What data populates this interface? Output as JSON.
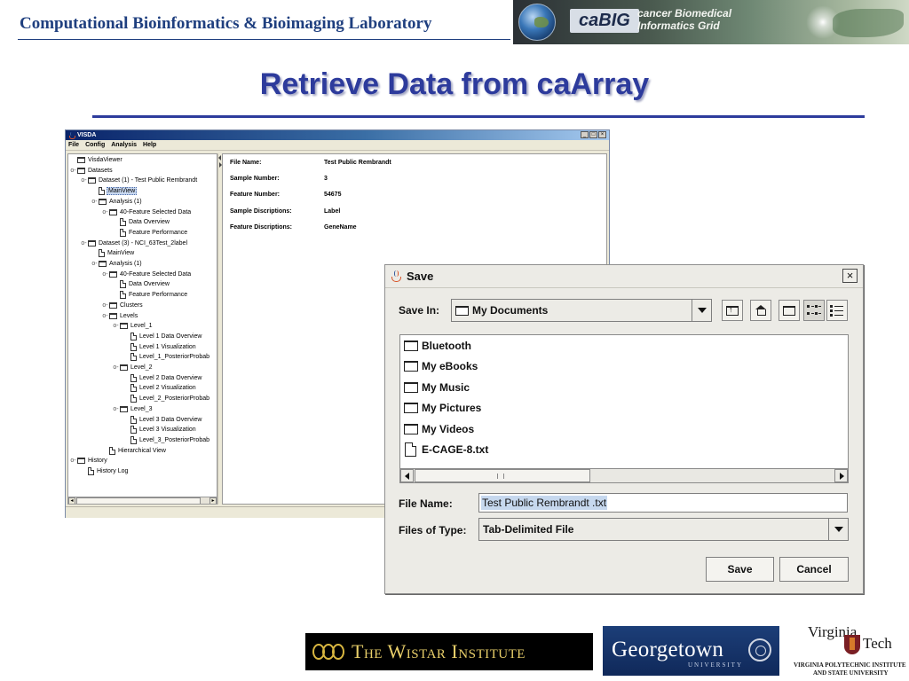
{
  "slide": {
    "lab_name": "Computational Bioinformatics & Bioimaging Laboratory",
    "title": "Retrieve Data from caArray",
    "banner": {
      "logo_text": "caBIG",
      "subtitle_line1": "cancer Biomedical",
      "subtitle_line2": "Informatics Grid"
    }
  },
  "visda": {
    "title": "VISDA",
    "menu": [
      "File",
      "Config",
      "Analysis",
      "Help"
    ],
    "tree": [
      {
        "label": "VisdaViewer",
        "icon": "folder-icon",
        "toggle": ""
      },
      {
        "label": "Datasets",
        "icon": "folder-icon",
        "toggle": "o-"
      },
      {
        "label": "Dataset (1) - Test Public Rembrandt",
        "icon": "folder-icon",
        "toggle": "o-"
      },
      {
        "label": "MainView",
        "icon": "file-icon",
        "toggle": "",
        "selected": true
      },
      {
        "label": "Analysis (1)",
        "icon": "folder-icon",
        "toggle": "o-"
      },
      {
        "label": "40-Feature Selected Data",
        "icon": "folder-icon",
        "toggle": "o-"
      },
      {
        "label": "Data Overview",
        "icon": "file-icon",
        "toggle": ""
      },
      {
        "label": "Feature Performance",
        "icon": "file-icon",
        "toggle": ""
      },
      {
        "label": "Dataset (3) - NCI_63Test_2label",
        "icon": "folder-icon",
        "toggle": "o-"
      },
      {
        "label": "MainView",
        "icon": "file-icon",
        "toggle": ""
      },
      {
        "label": "Analysis (1)",
        "icon": "folder-icon",
        "toggle": "o-"
      },
      {
        "label": "40-Feature Selected Data",
        "icon": "folder-icon",
        "toggle": "o-"
      },
      {
        "label": "Data Overview",
        "icon": "file-icon",
        "toggle": ""
      },
      {
        "label": "Feature Performance",
        "icon": "file-icon",
        "toggle": ""
      },
      {
        "label": "Clusters",
        "icon": "folder-icon",
        "toggle": "o-"
      },
      {
        "label": "Levels",
        "icon": "folder-icon",
        "toggle": "o-"
      },
      {
        "label": "Level_1",
        "icon": "folder-icon",
        "toggle": "o-"
      },
      {
        "label": "Level 1 Data Overview",
        "icon": "file-icon",
        "toggle": ""
      },
      {
        "label": "Level 1 Visualization",
        "icon": "file-icon",
        "toggle": ""
      },
      {
        "label": "Level_1_PosteriorProbab",
        "icon": "file-icon",
        "toggle": ""
      },
      {
        "label": "Level_2",
        "icon": "folder-icon",
        "toggle": "o-"
      },
      {
        "label": "Level 2 Data Overview",
        "icon": "file-icon",
        "toggle": ""
      },
      {
        "label": "Level 2 Visualization",
        "icon": "file-icon",
        "toggle": ""
      },
      {
        "label": "Level_2_PosteriorProbab",
        "icon": "file-icon",
        "toggle": ""
      },
      {
        "label": "Level_3",
        "icon": "folder-icon",
        "toggle": "o-"
      },
      {
        "label": "Level 3 Data Overview",
        "icon": "file-icon",
        "toggle": ""
      },
      {
        "label": "Level 3 Visualization",
        "icon": "file-icon",
        "toggle": ""
      },
      {
        "label": "Level_3_PosteriorProbab",
        "icon": "file-icon",
        "toggle": ""
      },
      {
        "label": "Hierarchical View",
        "icon": "file-icon",
        "toggle": ""
      },
      {
        "label": "History",
        "icon": "folder-icon",
        "toggle": "o-"
      },
      {
        "label": "History Log",
        "icon": "file-icon",
        "toggle": ""
      }
    ],
    "details": [
      {
        "key": "File Name:",
        "value": "Test Public Rembrandt"
      },
      {
        "key": "Sample Number:",
        "value": "3"
      },
      {
        "key": "Feature Number:",
        "value": "54675"
      },
      {
        "key": "Sample Discriptions:",
        "value": "Label"
      },
      {
        "key": "Feature Discriptions:",
        "value": "GeneName"
      }
    ]
  },
  "save_dialog": {
    "title": "Save",
    "close_glyph": "×",
    "save_in_label": "Save In:",
    "save_in_value": "My Documents",
    "files": [
      {
        "name": "Bluetooth",
        "icon": "folder-icon"
      },
      {
        "name": "My eBooks",
        "icon": "folder-icon"
      },
      {
        "name": "My Music",
        "icon": "folder-icon"
      },
      {
        "name": "My Pictures",
        "icon": "folder-icon"
      },
      {
        "name": "My Videos",
        "icon": "folder-icon"
      },
      {
        "name": "E-CAGE-8.txt",
        "icon": "file-icon"
      }
    ],
    "file_name_label": "File Name:",
    "file_name_value": "Test Public Rembrandt .txt",
    "file_type_label": "Files of Type:",
    "file_type_value": "Tab-Delimited File",
    "save_button": "Save",
    "cancel_button": "Cancel"
  },
  "footer": {
    "wistar": "The Wistar Institute",
    "georgetown": "Georgetown",
    "georgetown_sub": "UNIVERSITY",
    "vt_top": "Virginia",
    "vt_tech": "Tech",
    "vt_line1": "VIRGINIA POLYTECHNIC INSTITUTE",
    "vt_line2": "AND STATE UNIVERSITY"
  }
}
